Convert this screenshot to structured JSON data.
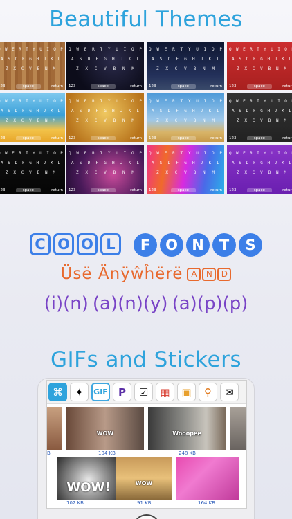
{
  "headings": {
    "themes": "Beautiful Themes",
    "gifs": "GIFs and Stickers"
  },
  "keyboard": {
    "row1": [
      "Q",
      "W",
      "E",
      "R",
      "T",
      "Y",
      "U",
      "I",
      "O",
      "P"
    ],
    "row2": [
      "A",
      "S",
      "D",
      "F",
      "G",
      "H",
      "J",
      "K",
      "L"
    ],
    "row3": [
      "Z",
      "X",
      "C",
      "V",
      "B",
      "N",
      "M"
    ],
    "key_123": "123",
    "key_space": "space",
    "key_return": "return"
  },
  "themes": [
    {
      "name": "wood",
      "bg": "#b07a45"
    },
    {
      "name": "space-stars",
      "bg": "#141425"
    },
    {
      "name": "night-sky",
      "bg": "#17203a"
    },
    {
      "name": "red",
      "bg": "#c0282c"
    },
    {
      "name": "beach",
      "bg": "#3fa8d8"
    },
    {
      "name": "gold-bokeh",
      "bg": "#c88a2a"
    },
    {
      "name": "desert-sky",
      "bg": "#6aa8d8"
    },
    {
      "name": "dark-gray",
      "bg": "#2b2b2b"
    },
    {
      "name": "black",
      "bg": "#0d0d0d"
    },
    {
      "name": "nebula",
      "bg": "#6a2a6a"
    },
    {
      "name": "rainbow",
      "bg": "#d8328a"
    },
    {
      "name": "purple",
      "bg": "#7a2ab8"
    }
  ],
  "fonts": {
    "cool_letters": [
      "C",
      "O",
      "O",
      "L"
    ],
    "fonts_letters": [
      "F",
      "O",
      "N",
      "T",
      "S"
    ],
    "use_anywhere": "Üsë Änÿŵĥërë",
    "and_letters": [
      "A",
      "N",
      "D"
    ],
    "in_app_words": [
      [
        "i",
        "n"
      ],
      [
        "a",
        "n",
        "y"
      ],
      [
        "a",
        "p",
        "p"
      ]
    ]
  },
  "gif_toolbar": {
    "icons": [
      "command-icon",
      "sticker-icon",
      "gif-icon",
      "p-icon",
      "check-icon",
      "calendar-icon",
      "image-icon",
      "search-icon",
      "translate-icon"
    ],
    "gif_label": "GIF",
    "p_label": "P"
  },
  "gifs": [
    {
      "size": "B",
      "caption": ""
    },
    {
      "size": "104 KB",
      "caption": "WOW"
    },
    {
      "size": "248 KB",
      "caption": "Wooopee"
    },
    {
      "size": "102 KB",
      "caption": "WOW!"
    },
    {
      "size": "91 KB",
      "caption": "WOW"
    },
    {
      "size": "164 KB",
      "caption": ""
    }
  ],
  "colors": {
    "heading_blue": "#2ea3dc",
    "font_blue": "#3c7fe8",
    "font_orange": "#e8692d",
    "font_purple": "#7944c6"
  }
}
